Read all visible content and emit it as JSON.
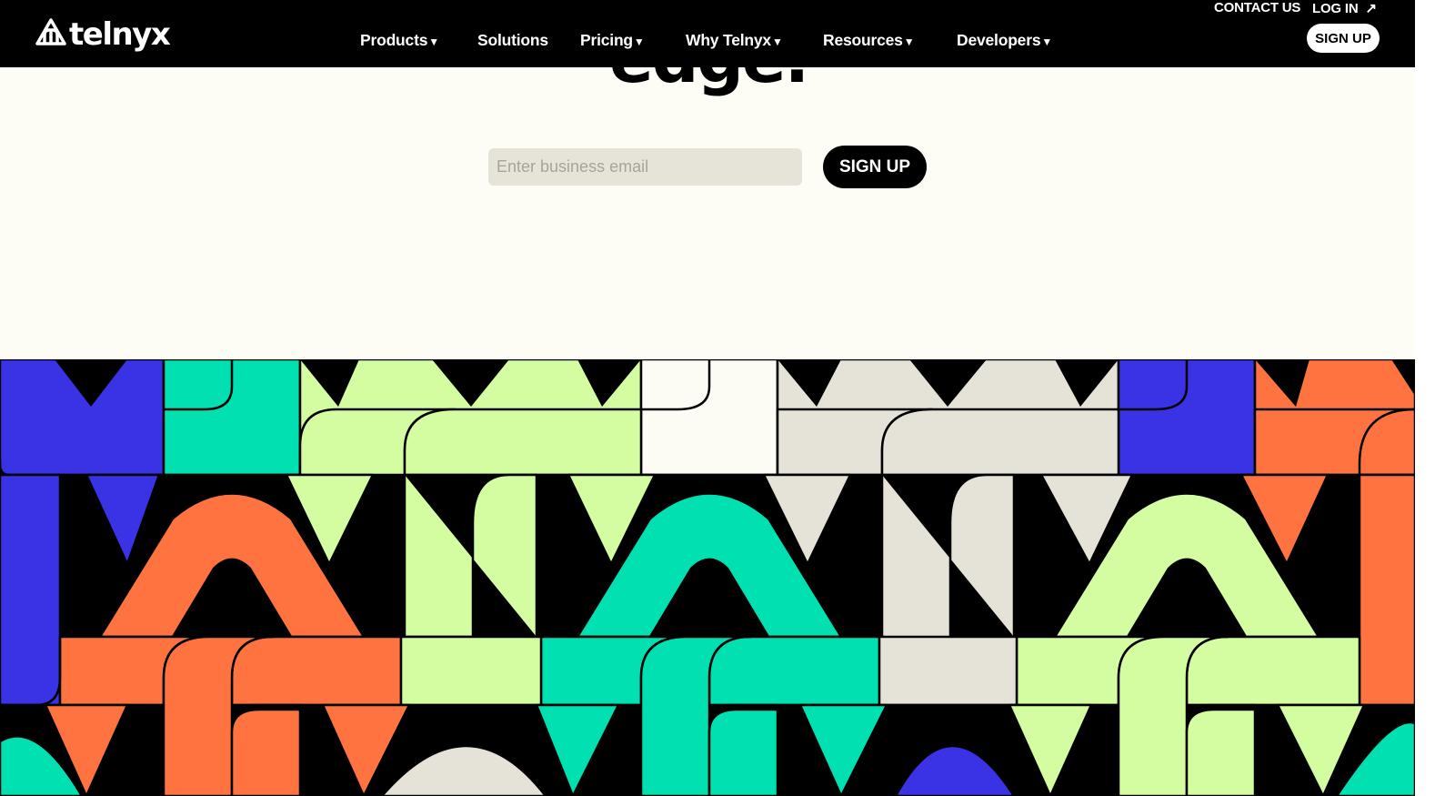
{
  "brand": {
    "name": "telnyx",
    "logo_icon": "telnyx-logo-icon"
  },
  "nav": {
    "items": [
      {
        "label": "Products",
        "has_dropdown": true
      },
      {
        "label": "Solutions",
        "has_dropdown": false
      },
      {
        "label": "Pricing",
        "has_dropdown": true
      },
      {
        "label": "Why Telnyx",
        "has_dropdown": true
      },
      {
        "label": "Resources",
        "has_dropdown": true
      },
      {
        "label": "Developers",
        "has_dropdown": true
      }
    ],
    "caret": "▼",
    "contact_label": "CONTACT US",
    "login_label": "LOG IN",
    "login_icon": "arrow-up-right-icon",
    "login_arrow_glyph": "↗",
    "signup_label": "SIGN UP"
  },
  "hero": {
    "heading_fragment": "edge.",
    "email_placeholder": "Enter business email",
    "email_value": "",
    "signup_label": "SIGN UP"
  },
  "colors": {
    "nav_bg": "#000000",
    "page_bg": "#fefdf5",
    "input_bg": "#e6e3d8",
    "pattern_blue": "#3a33e6",
    "pattern_green": "#00e0b0",
    "pattern_lime": "#d4fca0",
    "pattern_orange": "#fe7340",
    "pattern_cream": "#e5e2d7",
    "pattern_white": "#fdfcf4",
    "pattern_outline": "#000000"
  }
}
